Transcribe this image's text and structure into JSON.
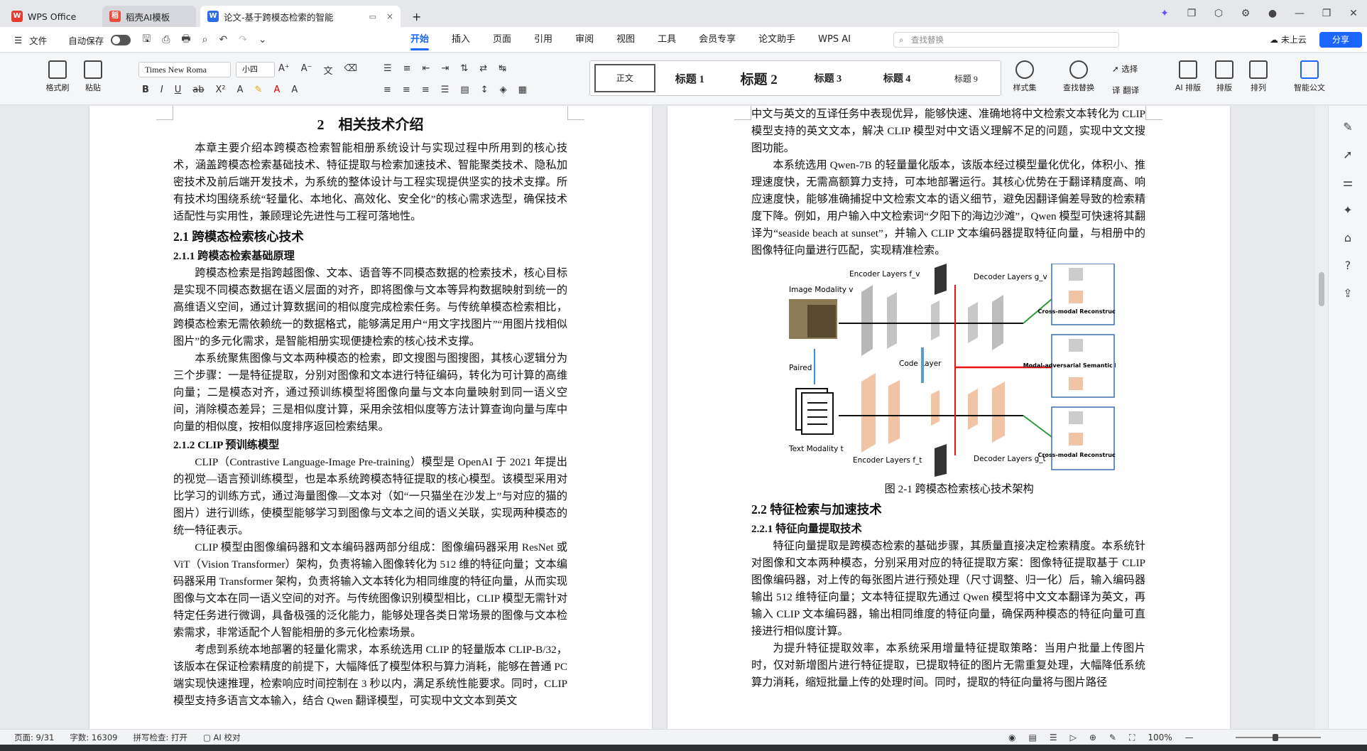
{
  "window": {
    "tabs": [
      {
        "label": "WPS Office",
        "icon": "wps-logo-icon"
      },
      {
        "label": "稻壳AI模板",
        "icon": "docer-icon"
      },
      {
        "label": "论文-基于跨模态检索的智能",
        "icon": "word-doc-icon"
      }
    ],
    "new_tab": "+",
    "close_tab": "×"
  },
  "menu": {
    "file": "文件",
    "autosave": "自动保存",
    "tabs": [
      "开始",
      "插入",
      "页面",
      "引用",
      "审阅",
      "视图",
      "工具",
      "会员专享",
      "论文助手",
      "WPS AI"
    ],
    "active_tab": "开始",
    "search_placeholder": "查找替换",
    "cloud": "未上云",
    "share": "分享"
  },
  "ribbon": {
    "format_painter": "格式刷",
    "paste": "粘贴",
    "font": "Times New Roma",
    "size": "小四",
    "styles": [
      "正文",
      "标题 1",
      "标题 2",
      "标题 3",
      "标题 4",
      "标题 9"
    ],
    "style_set": "样式集",
    "find_replace": "查找替换",
    "select": "选择",
    "translate": "翻译",
    "ai_layout": "AI 排版",
    "layout": "排版",
    "arrange": "排列",
    "smart_doc": "智能公文"
  },
  "page1": {
    "chapter": "2　相关技术介绍",
    "intro": "本章主要介绍本跨模态检索智能相册系统设计与实现过程中所用到的核心技术，涵盖跨模态检索基础技术、特征提取与检索加速技术、智能聚类技术、隐私加密技术及前后端开发技术，为系统的整体设计与工程实现提供坚实的技术支撑。所有技术均围绕系统“轻量化、本地化、高效化、安全化”的核心需求选型，确保技术适配性与实用性，兼顾理论先进性与工程可落地性。",
    "h21": "2.1  跨模态检索核心技术",
    "h211": "2.1.1  跨模态检索基础原理",
    "p211a": "跨模态检索是指跨越图像、文本、语音等不同模态数据的检索技术，核心目标是实现不同模态数据在语义层面的对齐，即将图像与文本等异构数据映射到统一的高维语义空间，通过计算数据间的相似度完成检索任务。与传统单模态检索相比，跨模态检索无需依赖统一的数据格式，能够满足用户“用文字找图片”“用图片找相似图片”的多元化需求，是智能相册实现便捷检索的核心技术支撑。",
    "p211b": "本系统聚焦图像与文本两种模态的检索，即文搜图与图搜图，其核心逻辑分为三个步骤：一是特征提取，分别对图像和文本进行特征编码，转化为可计算的高维向量；二是模态对齐，通过预训练模型将图像向量与文本向量映射到同一语义空间，消除模态差异；三是相似度计算，采用余弦相似度等方法计算查询向量与库中向量的相似度，按相似度排序返回检索结果。",
    "h212": "2.1.2  CLIP 预训练模型",
    "p212a": "CLIP（Contrastive Language-Image Pre-training）模型是 OpenAI 于 2021 年提出的视觉—语言预训练模型，也是本系统跨模态特征提取的核心模型。该模型采用对比学习的训练方式，通过海量图像—文本对（如“一只猫坐在沙发上”与对应的猫的图片）进行训练，使模型能够学习到图像与文本之间的语义关联，实现两种模态的统一特征表示。",
    "p212b": "CLIP 模型由图像编码器和文本编码器两部分组成：图像编码器采用 ResNet 或 ViT（Vision Transformer）架构，负责将输入图像转化为 512 维的特征向量；文本编码器采用 Transformer 架构，负责将输入文本转化为相同维度的特征向量，从而实现图像与文本在同一语义空间的对齐。与传统图像识别模型相比，CLIP 模型无需针对特定任务进行微调，具备极强的泛化能力，能够处理各类日常场景的图像与文本检索需求，非常适配个人智能相册的多元化检索场景。",
    "p212c": "考虑到系统本地部署的轻量化需求，本系统选用 CLIP 的轻量版本 CLIP-B/32，该版本在保证检索精度的前提下，大幅降低了模型体积与算力消耗，能够在普通 PC 端实现快速推理，检索响应时间控制在 3 秒以内，满足系统性能要求。同时，CLIP 模型支持多语言文本输入，结合 Qwen 翻译模型，可实现中文文本到英文"
  },
  "page2": {
    "p_cont": "中文与英文的互译任务中表现优异，能够快速、准确地将中文检索文本转化为 CLIP 模型支持的英文文本，解决 CLIP 模型对中文语义理解不足的问题，实现中文文搜图功能。",
    "p_qwen": "本系统选用 Qwen-7B 的轻量量化版本，该版本经过模型量化优化，体积小、推理速度快，无需高额算力支持，可本地部署运行。其核心优势在于翻译精度高、响应速度快，能够准确捕捉中文检索文本的语义细节，避免因翻译偏差导致的检索精度下降。例如，用户输入中文检索词“夕阳下的海边沙滩”，Qwen 模型可快速将其翻译为“seaside beach at sunset”，并输入 CLIP 文本编码器提取特征向量，与相册中的图像特征向量进行匹配，实现精准检索。",
    "figure": {
      "image_modality": "Image Modality v",
      "text_modality": "Text Modality t",
      "paired": "Paired",
      "encoder_v": "Encoder Layers f_v",
      "encoder_t": "Encoder Layers f_t",
      "decoder_v": "Decoder Layers g_v",
      "decoder_t": "Decoder Layers g_t",
      "code_layer": "Code Layer",
      "box1": "Cross-modal Reconstruction",
      "box2": "Modal-adversarial Semantic Learning",
      "box3": "Cross-modal Reconstruction"
    },
    "caption": "图 2-1  跨模态检索核心技术架构",
    "h22": "2.2  特征检索与加速技术",
    "h221": "2.2.1  特征向量提取技术",
    "p221a": "特征向量提取是跨模态检索的基础步骤，其质量直接决定检索精度。本系统针对图像和文本两种模态，分别采用对应的特征提取方案：图像特征提取基于 CLIP 图像编码器，对上传的每张图片进行预处理（尺寸调整、归一化）后，输入编码器输出 512 维特征向量；文本特征提取先通过 Qwen 模型将中文文本翻译为英文，再输入 CLIP 文本编码器，输出相同维度的特征向量，确保两种模态的特征向量可直接进行相似度计算。",
    "p221b": "为提升特征提取效率，本系统采用增量特征提取策略：当用户批量上传图片时，仅对新增图片进行特征提取，已提取特征的图片无需重复处理，大幅降低系统算力消耗，缩短批量上传的处理时间。同时，提取的特征向量将与图片路径"
  },
  "status": {
    "page": "页面: 9/31",
    "words": "字数: 16309",
    "spell": "拼写检查: 打开",
    "ai_check": "AI 校对",
    "zoom": "100%"
  }
}
